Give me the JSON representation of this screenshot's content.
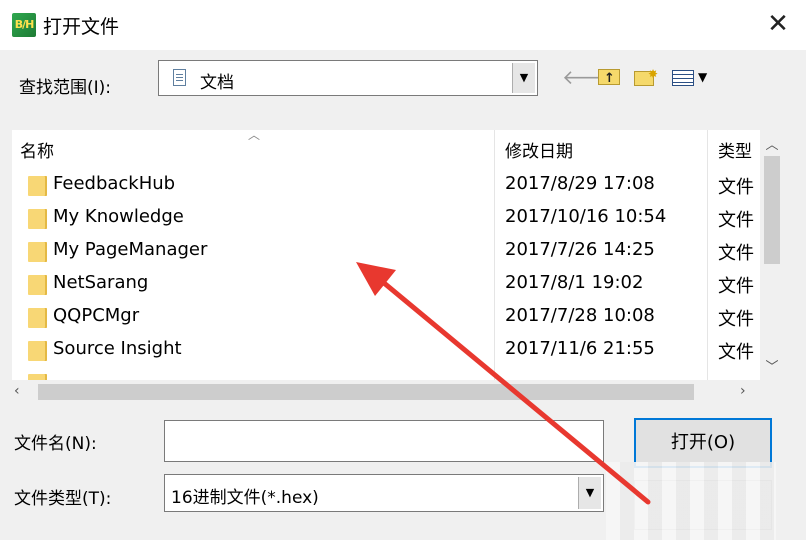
{
  "window": {
    "app_icon_text": "B/H",
    "title": "打开文件",
    "close_glyph": "✕"
  },
  "location": {
    "label": "查找范围(I):",
    "value": "文档"
  },
  "toolbar": {
    "icons": [
      "back-icon",
      "up-folder-icon",
      "new-folder-icon",
      "view-menu-icon"
    ]
  },
  "file_list": {
    "columns": [
      "名称",
      "修改日期",
      "类型"
    ],
    "rows": [
      {
        "name": "FeedbackHub",
        "date": "2017/8/29 17:08",
        "type": "文件"
      },
      {
        "name": "My Knowledge",
        "date": "2017/10/16 10:54",
        "type": "文件"
      },
      {
        "name": "My PageManager",
        "date": "2017/7/26 14:25",
        "type": "文件"
      },
      {
        "name": "NetSarang",
        "date": "2017/8/1 19:02",
        "type": "文件"
      },
      {
        "name": "QQPCMgr",
        "date": "2017/7/28 10:08",
        "type": "文件"
      },
      {
        "name": "Source Insight",
        "date": "2017/11/6 21:55",
        "type": "文件"
      }
    ]
  },
  "form": {
    "filename_label": "文件名(N):",
    "filename_value": "",
    "filetype_label": "文件类型(T):",
    "filetype_value": "16进制文件(*.hex)",
    "open_button": "打开(O)"
  },
  "colors": {
    "accent": "#0078d7",
    "annotation_arrow": "#e8382f",
    "folder": "#f8d775"
  }
}
